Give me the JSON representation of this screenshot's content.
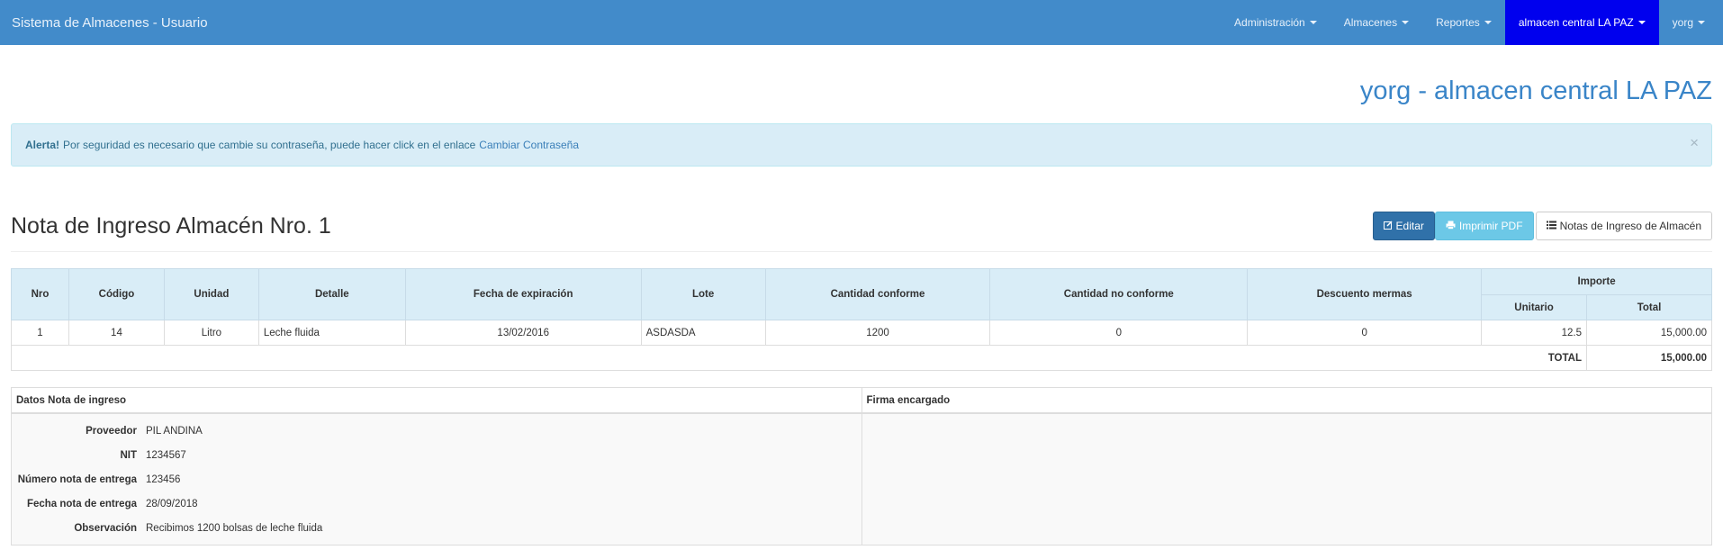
{
  "navbar": {
    "brand": "Sistema de Almacenes - Usuario",
    "menus": [
      {
        "label": "Administración"
      },
      {
        "label": "Almacenes"
      },
      {
        "label": "Reportes"
      },
      {
        "label": "almacen central LA PAZ"
      },
      {
        "label": "yorg"
      }
    ],
    "active_color": "#0000ee",
    "bar_color": "#428bca"
  },
  "header": {
    "title": "yorg - almacen central LA PAZ"
  },
  "alert": {
    "strong": "Alerta!",
    "text": "Por seguridad es necesario que cambie su contraseña, puede hacer click en el enlace",
    "link": "Cambiar Contraseña",
    "close": "×"
  },
  "section": {
    "title": "Nota de Ingreso Almacén Nro. 1",
    "buttons": {
      "edit": "Editar",
      "pdf": "Imprimir PDF",
      "list": "Notas de Ingreso de Almacén"
    }
  },
  "table": {
    "headers": {
      "nro": "Nro",
      "codigo": "Código",
      "unidad": "Unidad",
      "detalle": "Detalle",
      "fecha": "Fecha de expiración",
      "lote": "Lote",
      "conforme": "Cantidad conforme",
      "no_conforme": "Cantidad no conforme",
      "mermas": "Descuento mermas",
      "importe": "Importe",
      "unitario": "Unitario",
      "total": "Total"
    },
    "rows": [
      {
        "nro": "1",
        "codigo": "14",
        "unidad": "Litro",
        "detalle": "Leche fluida",
        "fecha": "13/02/2016",
        "lote": "ASDASDA",
        "conforme": "1200",
        "no_conforme": "0",
        "mermas": "0",
        "unitario": "12.5",
        "total": "15,000.00"
      }
    ],
    "total_label": "TOTAL",
    "total_value": "15,000.00"
  },
  "info": {
    "left_title": "Datos Nota de ingreso",
    "right_title": "Firma encargado",
    "fields": [
      {
        "label": "Proveedor",
        "value": "PIL ANDINA"
      },
      {
        "label": "NIT",
        "value": "1234567"
      },
      {
        "label": "Número nota de entrega",
        "value": "123456"
      },
      {
        "label": "Fecha nota de entrega",
        "value": "28/09/2018"
      },
      {
        "label": "Observación",
        "value": "Recibimos 1200 bolsas de leche fluida"
      }
    ]
  }
}
